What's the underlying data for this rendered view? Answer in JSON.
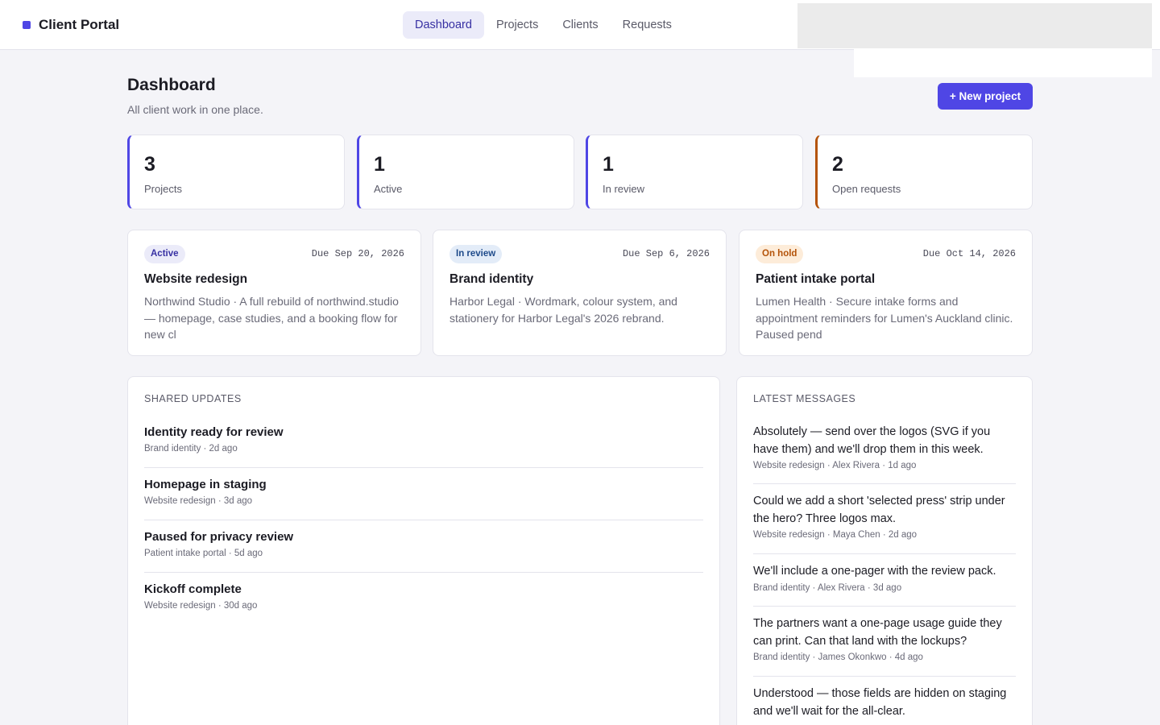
{
  "app": {
    "name": "Client Portal"
  },
  "nav": [
    {
      "label": "Dashboard",
      "active": true
    },
    {
      "label": "Projects",
      "active": false
    },
    {
      "label": "Clients",
      "active": false
    },
    {
      "label": "Requests",
      "active": false
    }
  ],
  "header": {
    "title": "Dashboard",
    "subtitle": "All client work in one place.",
    "new_project_label": "+ New project"
  },
  "stats": [
    {
      "value": "3",
      "label": "Projects"
    },
    {
      "value": "1",
      "label": "Active"
    },
    {
      "value": "1",
      "label": "In review"
    },
    {
      "value": "2",
      "label": "Open requests"
    }
  ],
  "projects": [
    {
      "status": "Active",
      "due": "Due Sep 20, 2026",
      "title": "Website redesign",
      "description": "Northwind Studio · A full rebuild of northwind.studio — homepage, case studies, and a booking flow for new cl"
    },
    {
      "status": "In review",
      "due": "Due Sep 6, 2026",
      "title": "Brand identity",
      "description": "Harbor Legal · Wordmark, colour system, and stationery for Harbor Legal's 2026 rebrand."
    },
    {
      "status": "On hold",
      "due": "Due Oct 14, 2026",
      "title": "Patient intake portal",
      "description": "Lumen Health · Secure intake forms and appointment reminders for Lumen's Auckland clinic. Paused pend"
    }
  ],
  "shared_updates": {
    "heading": "SHARED UPDATES",
    "items": [
      {
        "title": "Identity ready for review",
        "meta": "Brand identity · 2d ago"
      },
      {
        "title": "Homepage in staging",
        "meta": "Website redesign · 3d ago"
      },
      {
        "title": "Paused for privacy review",
        "meta": "Patient intake portal · 5d ago"
      },
      {
        "title": "Kickoff complete",
        "meta": "Website redesign · 30d ago"
      }
    ]
  },
  "latest_messages": {
    "heading": "LATEST MESSAGES",
    "items": [
      {
        "text": "Absolutely — send over the logos (SVG if you have them) and we'll drop them in this week.",
        "meta": "Website redesign · Alex Rivera · 1d ago"
      },
      {
        "text": "Could we add a short 'selected press' strip under the hero? Three logos max.",
        "meta": "Website redesign · Maya Chen · 2d ago"
      },
      {
        "text": "We'll include a one-pager with the review pack.",
        "meta": "Brand identity · Alex Rivera · 3d ago"
      },
      {
        "text": "The partners want a one-page usage guide they can print. Can that land with the lockups?",
        "meta": "Brand identity · James Okonkwo · 4d ago"
      },
      {
        "text": "Understood — those fields are hidden on staging and we'll wait for the all-clear.",
        "meta": ""
      }
    ]
  },
  "colors": {
    "accent": "#4f46e5",
    "warning": "#b45309",
    "background": "#f4f4f8"
  }
}
